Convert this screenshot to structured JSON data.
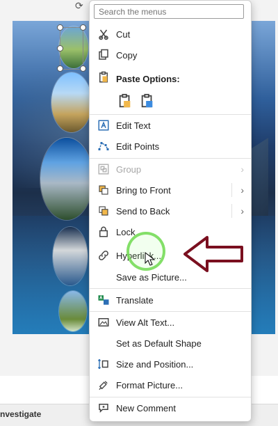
{
  "menu": {
    "search_placeholder": "Search the menus",
    "items": [
      {
        "label": "Cut",
        "icon": "scissors-icon"
      },
      {
        "label": "Copy",
        "icon": "copy-icon"
      },
      {
        "label": "Edit Text",
        "icon": "edit-text-icon"
      },
      {
        "label": "Edit Points",
        "icon": "edit-points-icon"
      },
      {
        "label": "Group",
        "icon": "group-icon",
        "disabled": true
      },
      {
        "label": "Bring to Front",
        "icon": "bring-to-front-icon"
      },
      {
        "label": "Send to Back",
        "icon": "send-to-back-icon"
      },
      {
        "label": "Lock",
        "icon": "lock-icon"
      },
      {
        "label": "Hyperlink...",
        "icon": "link-icon"
      },
      {
        "label": "Save as Picture...",
        "icon": "save-as-picture-icon"
      },
      {
        "label": "Translate",
        "icon": "translate-icon"
      },
      {
        "label": "View Alt Text...",
        "icon": "alt-text-icon"
      },
      {
        "label": "Set as Default Shape",
        "icon": "default-shape-icon"
      },
      {
        "label": "Size and Position...",
        "icon": "size-position-icon"
      },
      {
        "label": "Format Picture...",
        "icon": "format-picture-icon"
      },
      {
        "label": "New Comment",
        "icon": "comment-icon"
      }
    ],
    "paste_options_title": "Paste Options:"
  },
  "status_bar": {
    "text": "nvestigate"
  },
  "colors": {
    "menu_bg": "#ffffff",
    "disabled_text": "#a7a7a7",
    "highlight_ring": "#78dc5a",
    "callout_arrow": "#7a0f1f"
  }
}
